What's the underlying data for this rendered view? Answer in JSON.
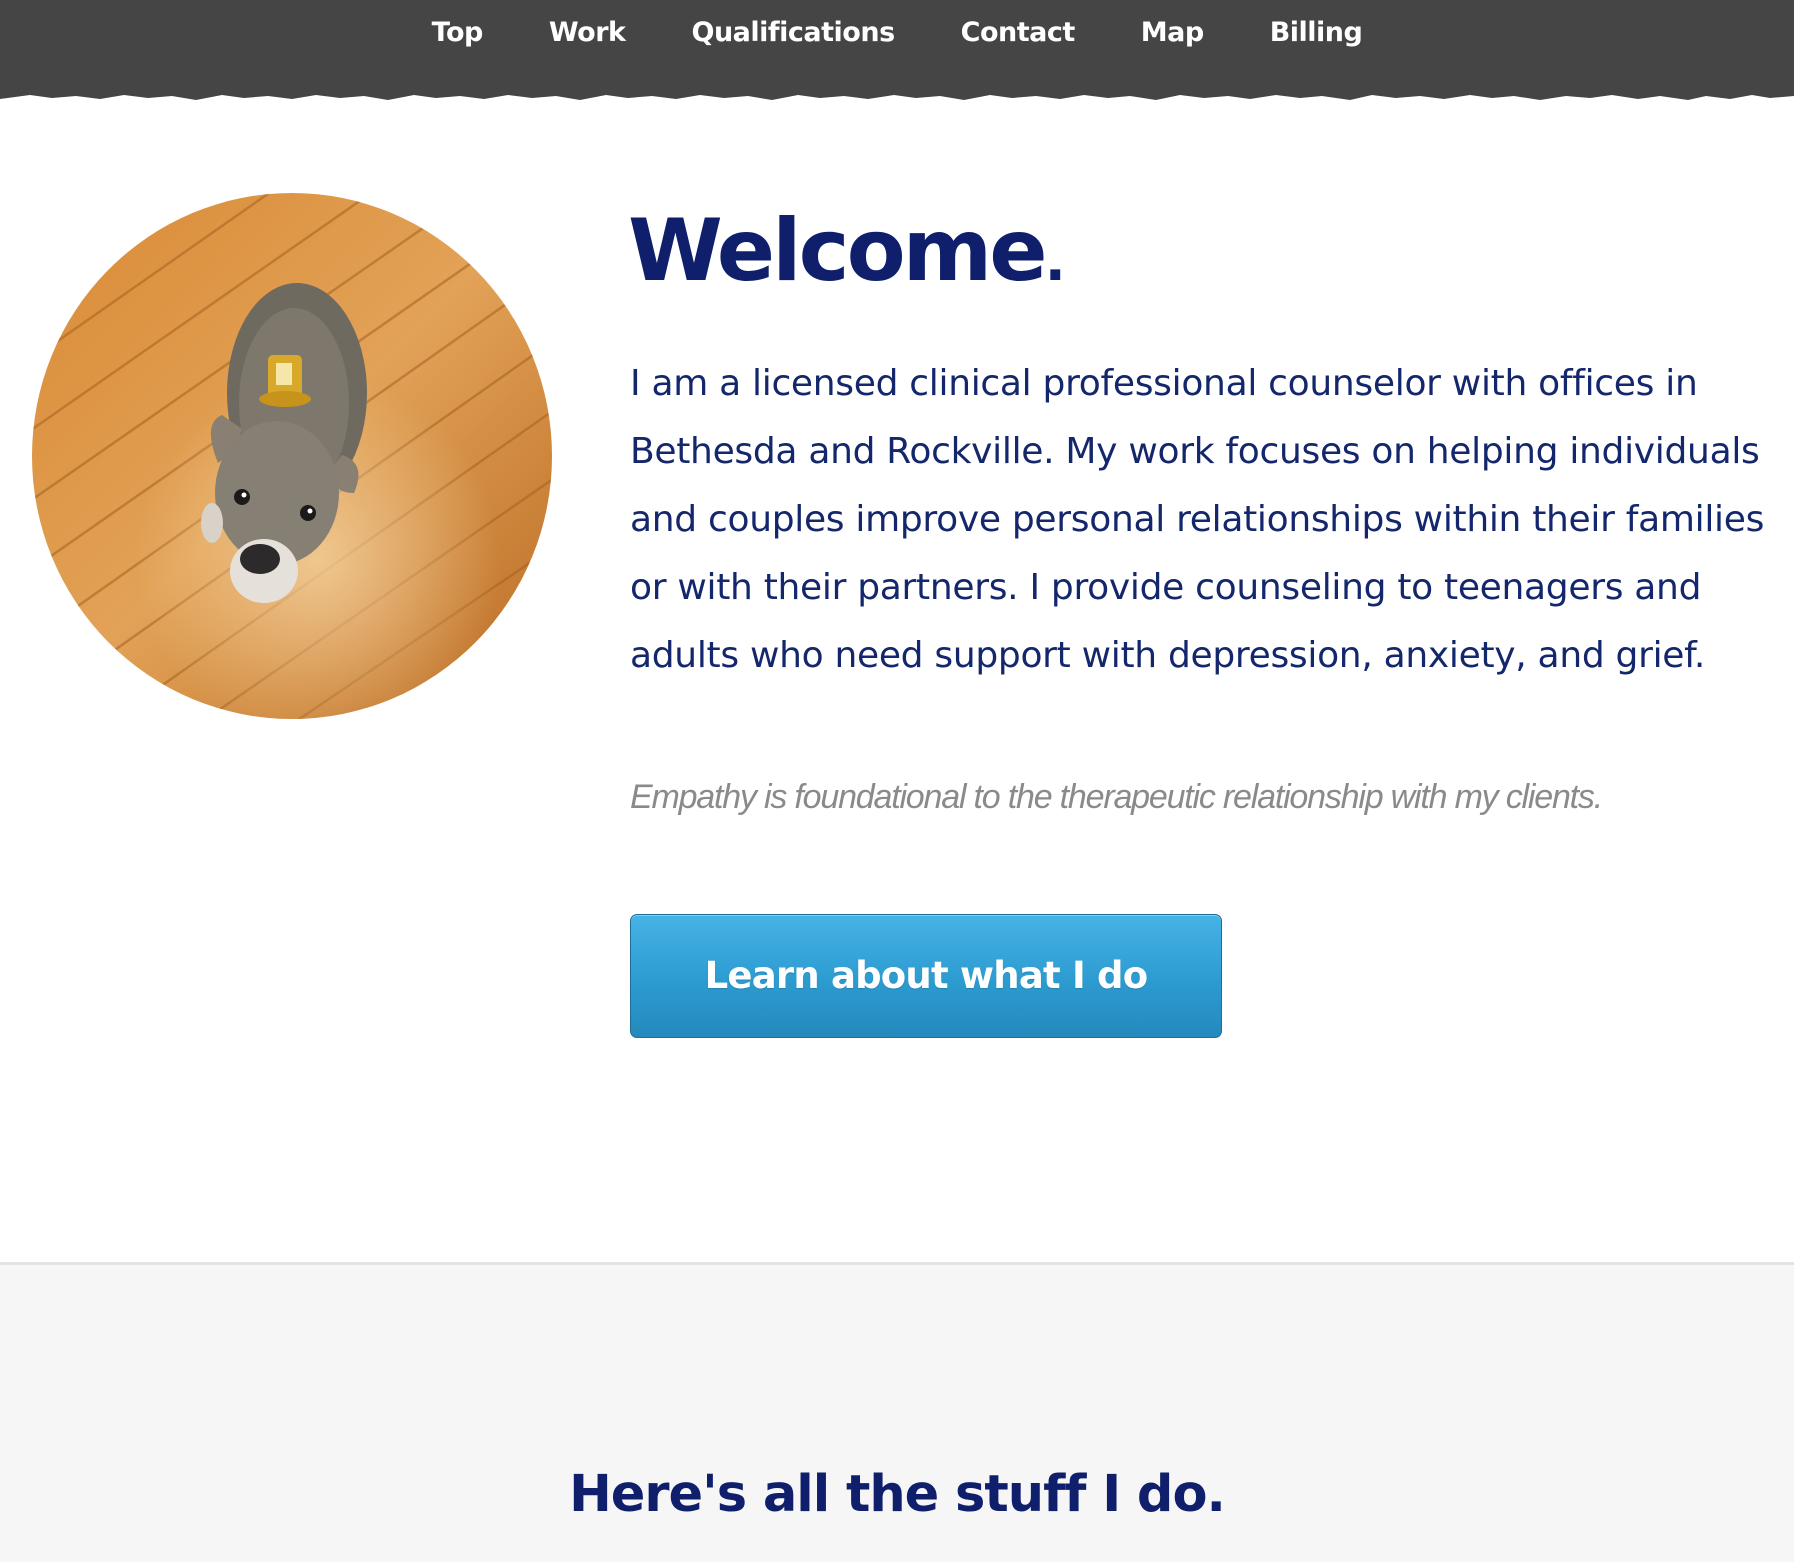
{
  "nav": {
    "items": [
      {
        "label": "Top"
      },
      {
        "label": "Work"
      },
      {
        "label": "Qualifications"
      },
      {
        "label": "Contact"
      },
      {
        "label": "Map"
      },
      {
        "label": "Billing"
      }
    ],
    "background": "#454545",
    "text_color": "#ffffff"
  },
  "hero": {
    "image": {
      "icon": "dog-photo"
    },
    "heading": "Welcome",
    "heading_punct": ".",
    "intro": "I am a licensed clinical professional counselor with offices in Bethesda and Rockville. My work focuses on helping individuals and couples improve personal relationships within their families or with their partners. I provide counseling to teenagers and adults who need support with depression, anxiety, and grief.",
    "tagline": "Empathy is foundational to the therapeutic relationship with my clients.",
    "cta_label": "Learn about what I do",
    "heading_color": "#0f1f6b",
    "button_color": "#2c9bd0"
  },
  "services": {
    "heading": "Here's all the stuff I do."
  }
}
